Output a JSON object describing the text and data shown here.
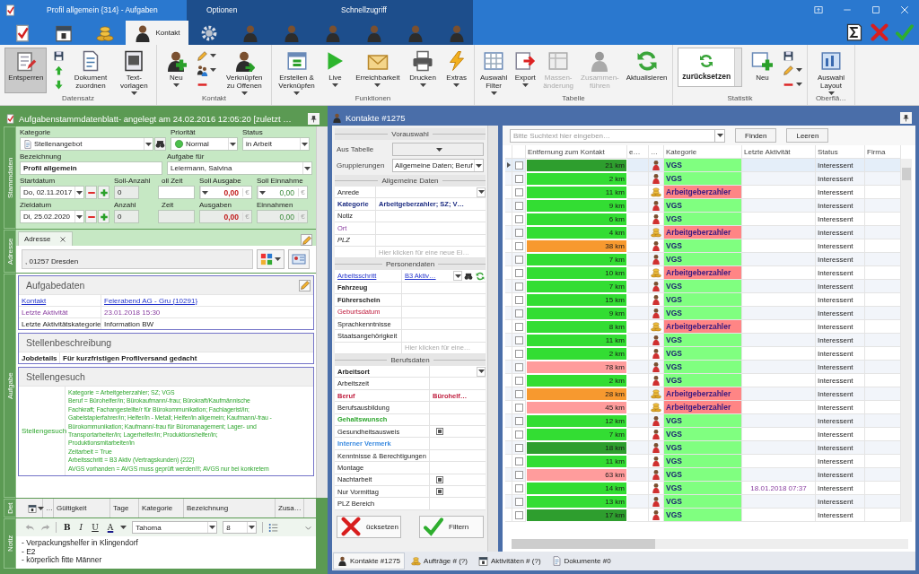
{
  "window": {
    "title": "Profil allgemein {314} - Aufgaben",
    "context_group": "Optionen",
    "quick_access": "Schnellzugriff"
  },
  "ribbon_tabs": [
    {
      "selected": false
    },
    {
      "selected": false
    },
    {
      "selected": false
    },
    {
      "label": "Kontakt",
      "selected": true
    },
    {
      "selected": false
    },
    {
      "selected": false
    },
    {
      "selected": false
    },
    {
      "selected": false
    },
    {
      "selected": false
    },
    {
      "selected": false
    },
    {
      "selected": false
    }
  ],
  "ribbon_groups": [
    {
      "label": "Datensatz",
      "items": [
        {
          "kind": "button",
          "label": "Entsperren",
          "pressed": true,
          "disabled": false,
          "dropdown": false
        },
        {
          "kind": "stack"
        },
        {
          "kind": "button",
          "label": "Dokument\nzuordnen",
          "pressed": false,
          "disabled": false,
          "dropdown": false
        },
        {
          "kind": "button",
          "label": "Text-\nvorlagen",
          "pressed": false,
          "disabled": false,
          "dropdown": true
        }
      ]
    },
    {
      "label": "Kontakt",
      "items": [
        {
          "kind": "button",
          "label": "Neu",
          "pressed": false,
          "disabled": false,
          "dropdown": true
        },
        {
          "kind": "stack"
        },
        {
          "kind": "button",
          "label": "Verknüpfen\nzu Offenen",
          "pressed": false,
          "disabled": false,
          "dropdown": true
        }
      ]
    },
    {
      "label": "Funktionen",
      "items": [
        {
          "kind": "button",
          "label": "Erstellen &\nVerknüpfen",
          "pressed": false,
          "disabled": false,
          "dropdown": true
        },
        {
          "kind": "button",
          "label": "Live",
          "pressed": false,
          "disabled": false,
          "dropdown": true
        },
        {
          "kind": "button",
          "label": "Erreichbarkeit",
          "pressed": false,
          "disabled": false,
          "dropdown": true
        },
        {
          "kind": "button",
          "label": "Drucken",
          "pressed": false,
          "disabled": false,
          "dropdown": true
        },
        {
          "kind": "button",
          "label": "Extras",
          "pressed": false,
          "disabled": false,
          "dropdown": true
        }
      ]
    },
    {
      "label": "Tabelle",
      "items": [
        {
          "kind": "button",
          "label": "Auswahl\nFilter",
          "pressed": false,
          "disabled": false,
          "dropdown": true
        },
        {
          "kind": "button",
          "label": "Export",
          "pressed": false,
          "disabled": false,
          "dropdown": true
        },
        {
          "kind": "button",
          "label": "Massen-\nänderung",
          "pressed": false,
          "disabled": true,
          "dropdown": false
        },
        {
          "kind": "button",
          "label": "Zusammen-\nführen",
          "pressed": false,
          "disabled": true,
          "dropdown": false
        },
        {
          "kind": "button",
          "label": "Aktualisieren",
          "pressed": false,
          "disabled": false,
          "dropdown": false
        }
      ]
    },
    {
      "label": "Statistik",
      "items": [
        {
          "kind": "combo",
          "value": "zurücksetzen"
        },
        {
          "kind": "button",
          "label": "Neu",
          "pressed": false,
          "disabled": false,
          "dropdown": false
        },
        {
          "kind": "stack"
        }
      ]
    },
    {
      "label": "Oberflä…",
      "items": [
        {
          "kind": "button",
          "label": "Auswahl\nLayout",
          "pressed": false,
          "disabled": false,
          "dropdown": true
        }
      ]
    }
  ],
  "task_sheet": {
    "title": "Aufgabenstammdatenblatt- angelegt am 24.02.2016 12:05:20 [zuletzt …",
    "sections": [
      {
        "kind": "form",
        "tab": "Stammdaten",
        "rows": [
          [
            {
              "label": "Kategorie",
              "kind": "lookup",
              "value": "Stellenangebot"
            },
            {
              "label": "Priorität",
              "kind": "priority",
              "value": "Normal"
            },
            {
              "label": "Status",
              "kind": "combo",
              "value": "in Arbeit"
            }
          ],
          [
            {
              "label": "Bezeichnung",
              "kind": "text",
              "value": "Profil allgemein"
            },
            {
              "label": "Aufgabe für",
              "kind": "combo",
              "value": "Leiermann, Salvina"
            }
          ],
          [
            {
              "label": "Startdatum",
              "kind": "date",
              "value": "Do, 02.11.2017"
            },
            {
              "label": "Soll-Anzahl",
              "kind": "number",
              "value": "0"
            },
            {
              "label": "oll Zeit",
              "kind": "blank",
              "readonly": false
            },
            {
              "label": "Soll Ausgabe",
              "kind": "expense",
              "value": "0,00",
              "currency": "€",
              "readonly": false
            },
            {
              "label": "Soll Einnahme",
              "kind": "income",
              "value": "0,00",
              "currency": "€",
              "readonly": false
            }
          ],
          [
            {
              "label": "Zieldatum",
              "kind": "date",
              "value": "Di, 25.02.2020"
            },
            {
              "label": "Anzahl",
              "kind": "number",
              "value": "0"
            },
            {
              "label": "Zeit",
              "kind": "blank",
              "readonly": true
            },
            {
              "label": "Ausgaben",
              "kind": "expense",
              "value": "0,00",
              "currency": "€",
              "readonly": true
            },
            {
              "label": "Einnahmen",
              "kind": "income",
              "value": "0,00",
              "currency": "€",
              "readonly": true
            }
          ]
        ]
      },
      {
        "kind": "address",
        "tab": "Adresse",
        "address_tab": "Adresse",
        "value": ", 01257 Dresden"
      },
      {
        "kind": "cards",
        "tab": "Aufgabe",
        "cards": [
          {
            "title": "Aufgabedaten",
            "editable": true,
            "rows": [
              {
                "label": "Kontakt",
                "value": "Feierabend AG - Gru {10291}",
                "kind": "link"
              },
              {
                "label": "Letzte Aktivität",
                "value": "23.01.2018 15:30",
                "kind": "activity"
              },
              {
                "label": "Letzte Aktivitätskategorie",
                "value": "Information BW",
                "kind": "plain"
              }
            ]
          },
          {
            "title": "Stellenbeschreibung",
            "editable": false,
            "rows": [
              {
                "label": "Jobdetails",
                "value": "Für kurzfristigen Profilversand gedacht",
                "kind": "strong"
              }
            ]
          },
          {
            "title": "Stellengesuch",
            "editable": false,
            "rows": [
              {
                "label": "Stellengesuch",
                "kind": "positive",
                "lines": [
                  "Kategorie = Arbeitgeberzahler; SZ; VGS",
                  "Beruf = Bürohelfer/in; Bürokaufmann/-frau; Bürokraft/Kaufmännische",
                  "Fachkraft; Fachangestellte/r für Bürokommunikation; Fachlagerist/in;",
                  "Gabelstaplerfahrer/in; Helfer/in - Metall; Helfer/in allgemein; Kaufmann/-frau -",
                  "Bürokommunikation; Kaufmann/-frau für Büromanagement; Lager- und",
                  "Transportarbeiter/in; Lagerhelfer/in; Produktionshelfer/in;",
                  "Produktionsmitarbeiter/in",
                  "Zeitarbeit = True",
                  "Arbeitsschritt = B3 Aktiv (Vertragskunden) {222}",
                  "AVGS vorhanden = AVGS muss geprüft werden!!!; AVGS nur bei konkretem"
                ]
              }
            ]
          }
        ]
      },
      {
        "kind": "details",
        "tab": "Det",
        "columns": [
          "…",
          "Gültigkeit",
          "Tage",
          "Kategorie",
          "Bezeichnung",
          "Zusa…"
        ]
      },
      {
        "kind": "note",
        "tab": "Notiz",
        "format": [
          "B",
          "I",
          "U",
          "A"
        ],
        "font": "Tahoma",
        "size": "8",
        "lines": [
          "- Verpackungshelfer in Klingendorf",
          "- E2",
          "- körperlich fitte Männer"
        ]
      }
    ]
  },
  "contacts": {
    "title": "Kontakte #1275",
    "filter": {
      "sections": [
        {
          "kind": "preselect",
          "title": "Vorauswahl",
          "rows": [
            {
              "label": "Aus Tabelle"
            },
            {
              "label": "Gruppierungen",
              "value": "Allgemeine Daten; Beruf"
            }
          ]
        },
        {
          "kind": "properties",
          "title": "Allgemeine Daten",
          "rows": [
            {
              "label": "Anrede",
              "kind": "plain",
              "dropdown": true
            },
            {
              "label": "Kategorie",
              "kind": "key",
              "value": "Arbeitgeberzahler; SZ; V…"
            },
            {
              "label": "Notiz",
              "kind": "plain"
            },
            {
              "label": "Ort",
              "kind": "highlight"
            },
            {
              "label": "PLZ",
              "kind": "italic"
            },
            {
              "kind": "new",
              "placeholder": "Hier klicken für eine neue Ei…"
            }
          ]
        },
        {
          "kind": "properties",
          "title": "Personendaten",
          "rows": [
            {
              "label": "Arbeitsschritt",
              "kind": "link",
              "dropdown": true,
              "value": "B3 Aktiv…"
            },
            {
              "label": "Fahrzeug",
              "kind": "strong"
            },
            {
              "label": "Führerschein",
              "kind": "strong"
            },
            {
              "label": "Geburtsdatum",
              "kind": "required"
            },
            {
              "label": "Sprachkenntnisse",
              "kind": "plain"
            },
            {
              "label": "Staatsangehörigkeit",
              "kind": "plain"
            },
            {
              "kind": "new",
              "placeholder": "Hier klicken für eine…"
            }
          ]
        },
        {
          "kind": "properties",
          "title": "Berufsdaten",
          "rows": [
            {
              "label": "Arbeitsort",
              "kind": "strong",
              "dropdown": true
            },
            {
              "label": "Arbeitszeit",
              "kind": "plain"
            },
            {
              "label": "Beruf",
              "kind": "critical",
              "value": "Bürohelf…"
            },
            {
              "label": "Berufsausbildung",
              "kind": "plain"
            },
            {
              "label": "Gehaltswunsch",
              "kind": "positive"
            },
            {
              "label": "Gesundheitsausweis",
              "kind": "plain",
              "checked": true
            },
            {
              "label": "Interner Vermerk",
              "kind": "info"
            },
            {
              "label": "Kenntnisse & Berechtigungen",
              "kind": "plain"
            },
            {
              "label": "Montage",
              "kind": "plain"
            },
            {
              "label": "Nachtarbeit",
              "kind": "plain",
              "checked": true
            },
            {
              "label": "Nur Vormittag",
              "kind": "plain",
              "checked": true
            },
            {
              "label": "PLZ Bereich",
              "kind": "plain"
            }
          ]
        }
      ],
      "buttons": [
        {
          "kind": "reset",
          "label": "ücksetzen"
        },
        {
          "kind": "apply",
          "label": "Filtern"
        }
      ]
    },
    "grid": {
      "search_placeholder": "Bitte Suchtext hier eingeben…",
      "buttons": [
        "Finden",
        "Leeren"
      ],
      "columns": [
        "Entfernung zum Kontakt",
        "e…",
        "…",
        "Kategorie",
        "Letzte Aktivität",
        "Status",
        "Firma"
      ],
      "rows": [
        {
          "selected": true,
          "checked": false,
          "distance": "21 km",
          "color": "#2e9e2e",
          "kind": "person",
          "category": "VGS",
          "status": "Interessent"
        },
        {
          "selected": false,
          "checked": false,
          "distance": "2 km",
          "color": "#33dd33",
          "kind": "person",
          "category": "VGS",
          "status": "Interessent"
        },
        {
          "selected": false,
          "checked": false,
          "distance": "11 km",
          "color": "#33dd33",
          "kind": "company",
          "category": "Arbeitgeberzahler",
          "status": "Interessent"
        },
        {
          "selected": false,
          "checked": false,
          "distance": "9 km",
          "color": "#33dd33",
          "kind": "person",
          "category": "VGS",
          "status": "Interessent"
        },
        {
          "selected": false,
          "checked": false,
          "distance": "6 km",
          "color": "#33dd33",
          "kind": "person",
          "category": "VGS",
          "status": "Interessent"
        },
        {
          "selected": false,
          "checked": false,
          "distance": "4 km",
          "color": "#33dd33",
          "kind": "company",
          "category": "Arbeitgeberzahler",
          "status": "Interessent"
        },
        {
          "selected": false,
          "checked": false,
          "distance": "38 km",
          "color": "#f7992f",
          "kind": "person",
          "category": "VGS",
          "status": "Interessent"
        },
        {
          "selected": false,
          "checked": false,
          "distance": "7 km",
          "color": "#33dd33",
          "kind": "person",
          "category": "VGS",
          "status": "Interessent"
        },
        {
          "selected": false,
          "checked": false,
          "distance": "10 km",
          "color": "#33dd33",
          "kind": "company",
          "category": "Arbeitgeberzahler",
          "status": "Interessent"
        },
        {
          "selected": false,
          "checked": false,
          "distance": "7 km",
          "color": "#33dd33",
          "kind": "person",
          "category": "VGS",
          "status": "Interessent"
        },
        {
          "selected": false,
          "checked": false,
          "distance": "15 km",
          "color": "#33dd33",
          "kind": "person",
          "category": "VGS",
          "status": "Interessent"
        },
        {
          "selected": false,
          "checked": false,
          "distance": "9 km",
          "color": "#33dd33",
          "kind": "person",
          "category": "VGS",
          "status": "Interessent"
        },
        {
          "selected": false,
          "checked": false,
          "distance": "8 km",
          "color": "#33dd33",
          "kind": "company",
          "category": "Arbeitgeberzahler",
          "status": "Interessent"
        },
        {
          "selected": false,
          "checked": false,
          "distance": "11 km",
          "color": "#33dd33",
          "kind": "person",
          "category": "VGS",
          "status": "Interessent"
        },
        {
          "selected": false,
          "checked": false,
          "distance": "2 km",
          "color": "#33dd33",
          "kind": "person",
          "category": "VGS",
          "status": "Interessent"
        },
        {
          "selected": false,
          "checked": false,
          "distance": "78 km",
          "color": "#ff9c9c",
          "kind": "person",
          "category": "VGS",
          "status": "Interessent"
        },
        {
          "selected": false,
          "checked": false,
          "distance": "2 km",
          "color": "#33dd33",
          "kind": "person",
          "category": "VGS",
          "status": "Interessent"
        },
        {
          "selected": false,
          "checked": false,
          "distance": "28 km",
          "color": "#f7992f",
          "kind": "company",
          "category": "Arbeitgeberzahler",
          "status": "Interessent"
        },
        {
          "selected": false,
          "checked": false,
          "distance": "45 km",
          "color": "#ff9c9c",
          "kind": "company",
          "category": "Arbeitgeberzahler",
          "status": "Interessent"
        },
        {
          "selected": false,
          "checked": false,
          "distance": "12 km",
          "color": "#33dd33",
          "kind": "person",
          "category": "VGS",
          "status": "Interessent"
        },
        {
          "selected": false,
          "checked": false,
          "distance": "7 km",
          "color": "#33dd33",
          "kind": "person",
          "category": "VGS",
          "status": "Interessent"
        },
        {
          "selected": false,
          "checked": false,
          "distance": "18 km",
          "color": "#2e9e2e",
          "kind": "person",
          "category": "VGS",
          "status": "Interessent"
        },
        {
          "selected": false,
          "checked": false,
          "distance": "11 km",
          "color": "#33dd33",
          "kind": "person",
          "category": "VGS",
          "status": "Interessent"
        },
        {
          "selected": false,
          "checked": false,
          "distance": "63 km",
          "color": "#ff9c9c",
          "kind": "person",
          "category": "VGS",
          "status": "Interessent"
        },
        {
          "selected": false,
          "checked": false,
          "distance": "14 km",
          "color": "#33dd33",
          "kind": "person",
          "category": "VGS",
          "activity": "18.01.2018 07:37",
          "status": "Interessent"
        },
        {
          "selected": false,
          "checked": false,
          "distance": "13 km",
          "color": "#33dd33",
          "kind": "person",
          "category": "VGS",
          "status": "Interessent"
        },
        {
          "selected": false,
          "checked": false,
          "distance": "17 km",
          "color": "#2e9e2e",
          "kind": "person",
          "category": "VGS",
          "status": "Interessent"
        }
      ]
    },
    "tabs": [
      {
        "label": "Kontakte #1275",
        "selected": true
      },
      {
        "label": "Aufträge # (?)",
        "selected": false
      },
      {
        "label": "Aktivitäten # (?)",
        "selected": false
      },
      {
        "label": "Dokumente #0",
        "selected": false
      }
    ]
  }
}
